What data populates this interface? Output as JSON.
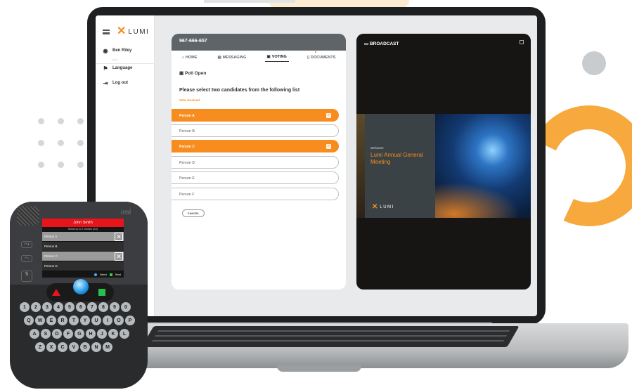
{
  "colors": {
    "accent": "#f78d1e",
    "header": "#5e6468",
    "broadcast_bg": "#171513",
    "lcd_header": "#e8141c"
  },
  "sidebar": {
    "logo_text": "LUMI",
    "logo_mark": "✕",
    "user_name": "Ben Riley",
    "user_sub": "Lumi",
    "items": [
      {
        "label": "Language",
        "icon": "flag-icon"
      },
      {
        "label": "Log out",
        "icon": "logout-icon"
      }
    ]
  },
  "voting": {
    "meeting_id": "967-666-657",
    "tabs": [
      {
        "label": "HOME",
        "icon": "home-icon",
        "active": false
      },
      {
        "label": "MESSAGING",
        "icon": "chat-icon",
        "active": false
      },
      {
        "label": "VOTING",
        "icon": "ballot-icon",
        "active": true
      },
      {
        "label": "DOCUMENTS",
        "icon": "document-icon",
        "active": false
      }
    ],
    "poll_status": "Poll Open",
    "question": "Please select two candidates from the following list",
    "vote_status": "Vote received",
    "candidates": [
      {
        "label": "Person A",
        "selected": true
      },
      {
        "label": "Person B",
        "selected": false
      },
      {
        "label": "Person C",
        "selected": true
      },
      {
        "label": "Person D",
        "selected": false
      },
      {
        "label": "Person E",
        "selected": false
      },
      {
        "label": "Person F",
        "selected": false
      }
    ],
    "cancel_label": "CANCEL"
  },
  "broadcast": {
    "title": "BROADCAST",
    "welcome": "Welcome",
    "meeting_title": "Lumi Annual General Meeting",
    "logo_text": "LUMI"
  },
  "device": {
    "brand": "iml",
    "lcd_title": "John Smith",
    "lcd_subtitle": "Select up to 2 choices (2/2)",
    "options": [
      {
        "label": "Person A",
        "selected": true
      },
      {
        "label": "Person B",
        "selected": false
      },
      {
        "label": "Person C",
        "selected": true
      },
      {
        "label": "Person D",
        "selected": false
      }
    ],
    "select_label": "Select",
    "send_label": "Send",
    "key_rows": [
      [
        "1",
        "2",
        "3",
        "4",
        "5",
        "6",
        "7",
        "8",
        "9",
        "0"
      ],
      [
        "Q",
        "W",
        "E",
        "R",
        "T",
        "Y",
        "U",
        "I",
        "O",
        "P"
      ],
      [
        "A",
        "S",
        "D",
        "F",
        "G",
        "H",
        "J",
        "K",
        "L"
      ],
      [
        "Z",
        "X",
        "C",
        "V",
        "B",
        "N",
        "M"
      ]
    ]
  }
}
